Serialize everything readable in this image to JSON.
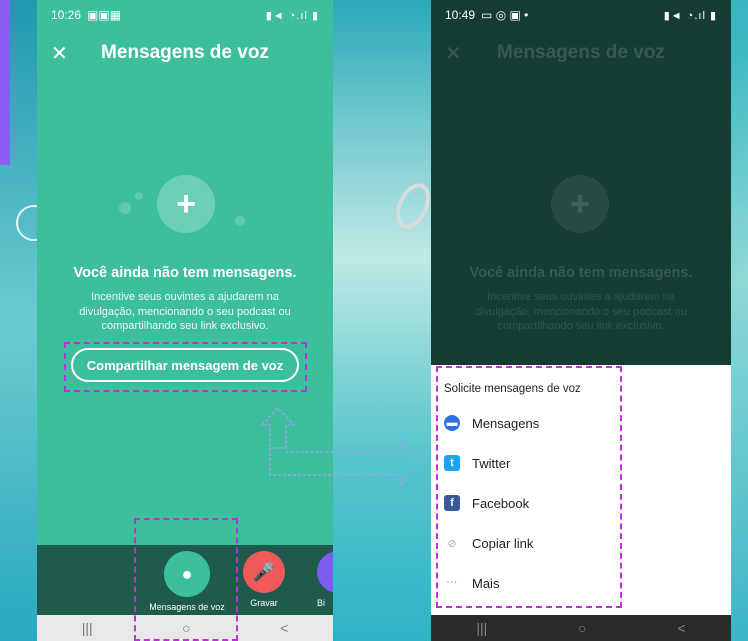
{
  "left_phone": {
    "status_time": "10:26",
    "title": "Mensagens de voz",
    "close_label": "✕",
    "empty_title": "Você ainda não tem mensagens.",
    "empty_subtitle": "Incentive seus ouvintes a ajudarem na divulgação, mencionando o seu podcast ou compartilhando seu link exclusivo.",
    "share_button": "Compartilhar mensagem de voz",
    "nav": [
      {
        "label": "Mensagens de voz",
        "icon": "plus-bubble-icon",
        "color": "#3dbf9d"
      },
      {
        "label": "Gravar",
        "icon": "microphone-icon",
        "color": "#f05a5a"
      },
      {
        "label": "Bi",
        "icon": "library-icon",
        "color": "#7c5cf0"
      }
    ]
  },
  "right_phone": {
    "status_time": "10:49",
    "title": "Mensagens de voz",
    "empty_title": "Você ainda não tem mensagens.",
    "empty_subtitle": "Incentive seus ouvintes a ajudarem na divulgação, mencionando o seu podcast ou compartilhando seu link exclusivo.",
    "sheet": {
      "title": "Solicite mensagens de voz",
      "options": [
        {
          "label": "Mensagens",
          "icon": "messages-icon",
          "color": "#2f6fe4"
        },
        {
          "label": "Twitter",
          "icon": "twitter-icon",
          "color": "#1da1f2"
        },
        {
          "label": "Facebook",
          "icon": "facebook-icon",
          "color": "#3b5998"
        },
        {
          "label": "Copiar link",
          "icon": "link-icon",
          "color": "#cccccc"
        },
        {
          "label": "Mais",
          "icon": "more-icon",
          "color": "#cccccc"
        }
      ]
    }
  },
  "sysnav": {
    "recent": "|||",
    "home": "○",
    "back": "<"
  }
}
